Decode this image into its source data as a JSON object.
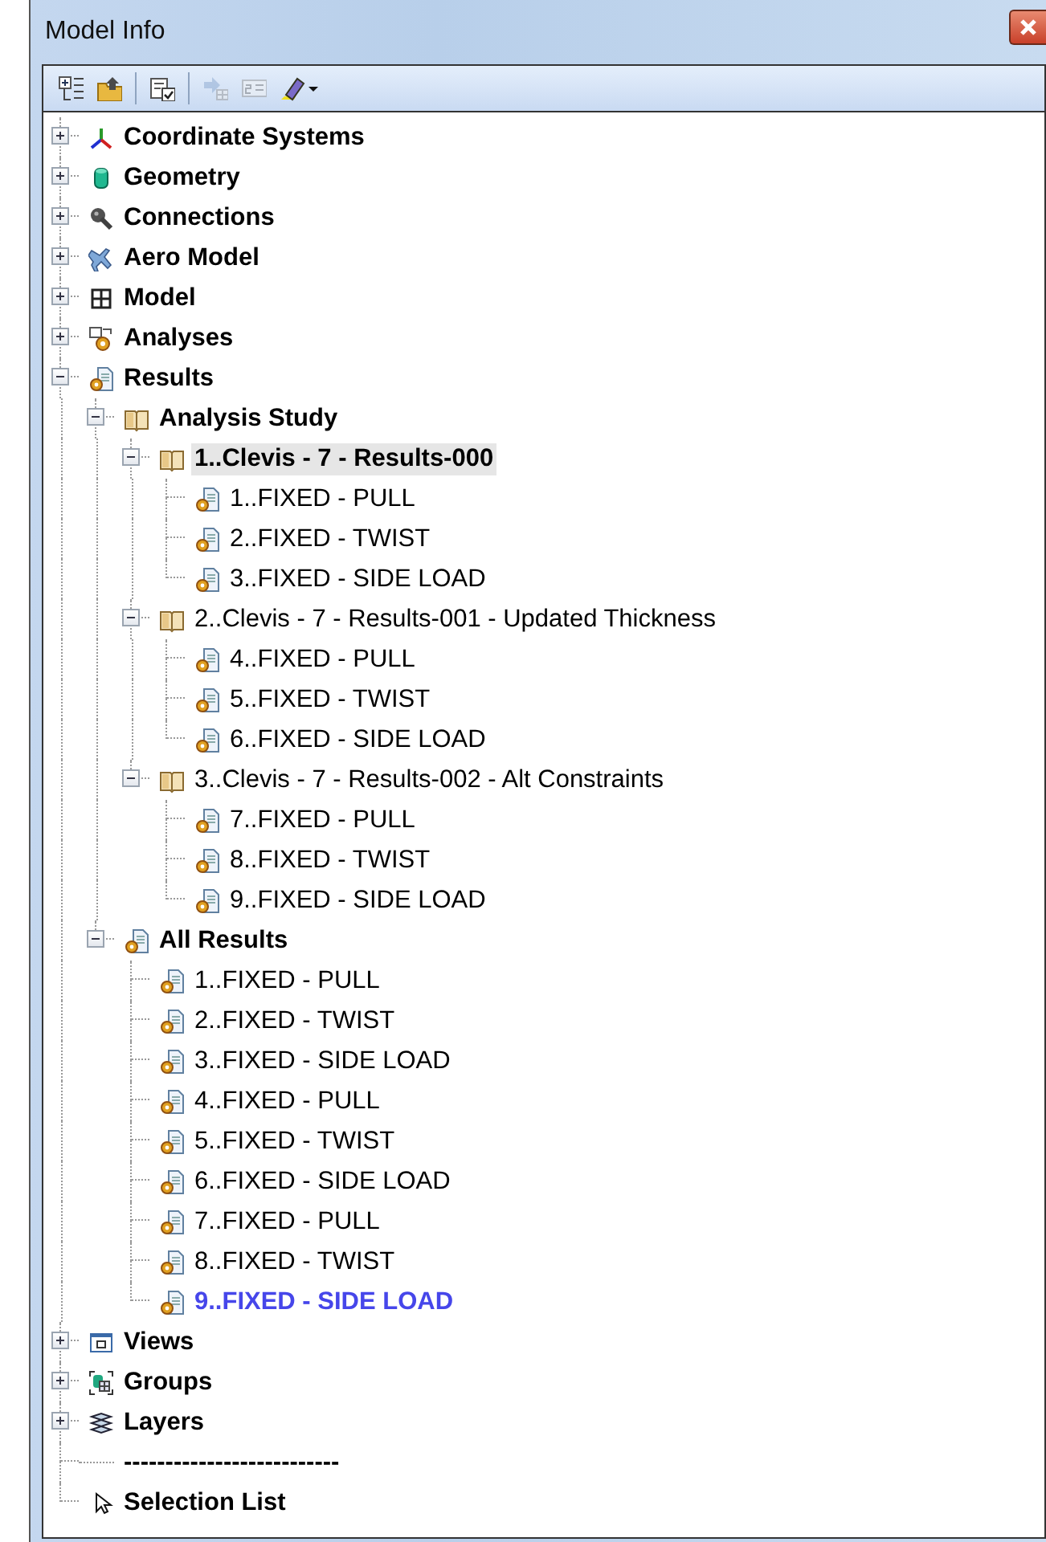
{
  "window": {
    "title": "Model Info"
  },
  "toolbar": {
    "groups": [
      {
        "buttons": [
          {
            "kind": "tree",
            "disabled": false,
            "dropdown": false
          },
          {
            "kind": "folder",
            "disabled": false,
            "dropdown": false
          }
        ]
      },
      {
        "buttons": [
          {
            "kind": "checklist",
            "disabled": false,
            "dropdown": false
          }
        ]
      },
      {
        "buttons": [
          {
            "kind": "move",
            "disabled": true,
            "dropdown": false
          },
          {
            "kind": "rename",
            "disabled": true,
            "dropdown": false
          },
          {
            "kind": "highlighter",
            "disabled": false,
            "dropdown": true
          }
        ]
      }
    ]
  },
  "tree": {
    "items": [
      {
        "label": "Coordinate Systems",
        "kind": "axes",
        "bold": true,
        "selected": false,
        "active": false,
        "expanded": false
      },
      {
        "label": "Geometry",
        "kind": "cylinder",
        "bold": true,
        "selected": false,
        "active": false,
        "expanded": false
      },
      {
        "label": "Connections",
        "kind": "pin",
        "bold": true,
        "selected": false,
        "active": false,
        "expanded": false
      },
      {
        "label": "Aero Model",
        "kind": "airplane",
        "bold": true,
        "selected": false,
        "active": false,
        "expanded": false
      },
      {
        "label": "Model",
        "kind": "grid",
        "bold": true,
        "selected": false,
        "active": false,
        "expanded": false
      },
      {
        "label": "Analyses",
        "kind": "analyses",
        "bold": true,
        "selected": false,
        "active": false,
        "expanded": false
      },
      {
        "label": "Results",
        "kind": "result",
        "bold": true,
        "selected": false,
        "active": false,
        "expanded": true,
        "children": [
          {
            "label": "Analysis Study",
            "kind": "book",
            "bold": true,
            "selected": false,
            "active": false,
            "expanded": true,
            "children": [
              {
                "label": "1..Clevis - 7 - Results-000",
                "kind": "book",
                "bold": true,
                "selected": false,
                "active": true,
                "expanded": true,
                "children": [
                  {
                    "label": "1..FIXED - PULL",
                    "kind": "result",
                    "bold": false,
                    "selected": false,
                    "active": false
                  },
                  {
                    "label": "2..FIXED - TWIST",
                    "kind": "result",
                    "bold": false,
                    "selected": false,
                    "active": false
                  },
                  {
                    "label": "3..FIXED - SIDE LOAD",
                    "kind": "result",
                    "bold": false,
                    "selected": false,
                    "active": false
                  }
                ]
              },
              {
                "label": "2..Clevis - 7 - Results-001 - Updated Thickness",
                "kind": "book",
                "bold": false,
                "selected": false,
                "active": false,
                "expanded": true,
                "children": [
                  {
                    "label": "4..FIXED - PULL",
                    "kind": "result",
                    "bold": false,
                    "selected": false,
                    "active": false
                  },
                  {
                    "label": "5..FIXED - TWIST",
                    "kind": "result",
                    "bold": false,
                    "selected": false,
                    "active": false
                  },
                  {
                    "label": "6..FIXED - SIDE LOAD",
                    "kind": "result",
                    "bold": false,
                    "selected": false,
                    "active": false
                  }
                ]
              },
              {
                "label": "3..Clevis - 7 - Results-002 - Alt Constraints",
                "kind": "book",
                "bold": false,
                "selected": false,
                "active": false,
                "expanded": true,
                "children": [
                  {
                    "label": "7..FIXED - PULL",
                    "kind": "result",
                    "bold": false,
                    "selected": false,
                    "active": false
                  },
                  {
                    "label": "8..FIXED - TWIST",
                    "kind": "result",
                    "bold": false,
                    "selected": false,
                    "active": false
                  },
                  {
                    "label": "9..FIXED - SIDE LOAD",
                    "kind": "result",
                    "bold": false,
                    "selected": false,
                    "active": false
                  }
                ]
              }
            ]
          },
          {
            "label": "All Results",
            "kind": "result",
            "bold": true,
            "selected": false,
            "active": false,
            "expanded": true,
            "children": [
              {
                "label": "1..FIXED - PULL",
                "kind": "result",
                "bold": false,
                "selected": false,
                "active": false
              },
              {
                "label": "2..FIXED - TWIST",
                "kind": "result",
                "bold": false,
                "selected": false,
                "active": false
              },
              {
                "label": "3..FIXED - SIDE LOAD",
                "kind": "result",
                "bold": false,
                "selected": false,
                "active": false
              },
              {
                "label": "4..FIXED - PULL",
                "kind": "result",
                "bold": false,
                "selected": false,
                "active": false
              },
              {
                "label": "5..FIXED - TWIST",
                "kind": "result",
                "bold": false,
                "selected": false,
                "active": false
              },
              {
                "label": "6..FIXED - SIDE LOAD",
                "kind": "result",
                "bold": false,
                "selected": false,
                "active": false
              },
              {
                "label": "7..FIXED - PULL",
                "kind": "result",
                "bold": false,
                "selected": false,
                "active": false
              },
              {
                "label": "8..FIXED - TWIST",
                "kind": "result",
                "bold": false,
                "selected": false,
                "active": false
              },
              {
                "label": "9..FIXED - SIDE LOAD",
                "kind": "result",
                "bold": true,
                "selected": true,
                "active": false
              }
            ]
          }
        ]
      },
      {
        "label": "Views",
        "kind": "view",
        "bold": true,
        "selected": false,
        "active": false,
        "expanded": false
      },
      {
        "label": "Groups",
        "kind": "groups",
        "bold": true,
        "selected": false,
        "active": false,
        "expanded": false
      },
      {
        "label": "Layers",
        "kind": "layers",
        "bold": true,
        "selected": false,
        "active": false,
        "expanded": false
      },
      {
        "label": "--------------------------",
        "kind": "separator",
        "bold": true,
        "selected": false,
        "active": false
      },
      {
        "label": "Selection List",
        "kind": "pointer",
        "bold": true,
        "selected": false,
        "active": false
      }
    ]
  }
}
